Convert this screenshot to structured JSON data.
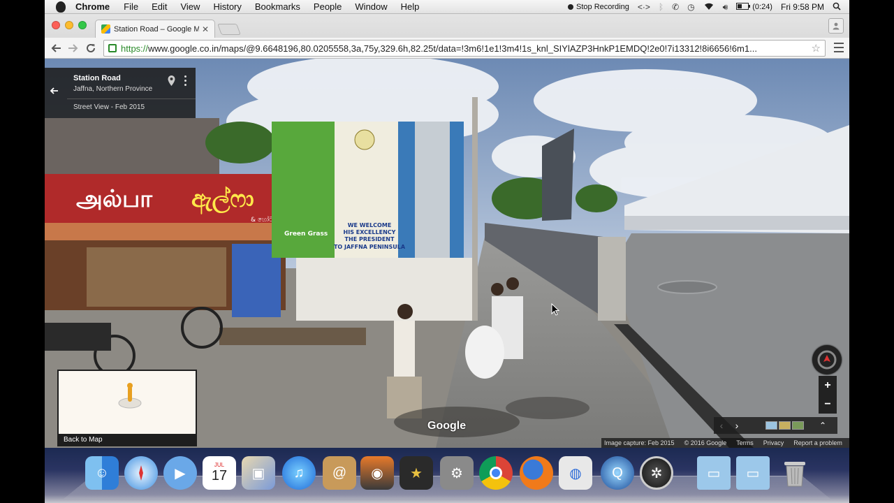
{
  "menubar": {
    "app_name": "Chrome",
    "menus": [
      "File",
      "Edit",
      "View",
      "History",
      "Bookmarks",
      "People",
      "Window",
      "Help"
    ],
    "recording_label": "Stop Recording",
    "battery_time": "(0:24)",
    "clock": "Fri 9:58 PM"
  },
  "browser": {
    "tab_title": "Station Road – Google Ma",
    "url_scheme": "https://",
    "url_rest": "www.google.co.in/maps/@9.6648196,80.0205558,3a,75y,329.6h,82.25t/data=!3m6!1e1!3m4!1s_knl_SIYlAZP3HnkP1EMDQ!2e0!7i13312!8i6656!6m1..."
  },
  "streetview": {
    "place_title": "Station Road",
    "place_subtitle": "Jaffna, Northern Province",
    "capture_label": "Street View - Feb 2015",
    "back_to_map": "Back to Map",
    "logo": "Google",
    "billboard_lines": [
      "WE WELCOME",
      "HIS EXCELLENCY",
      "THE PRESIDENT",
      "TO JAFFNA PENINSULA"
    ],
    "billboard_brand": "Green Grass",
    "shop_signs": [
      "அல்பா",
      "ඇල්ෆා"
    ],
    "shop_sign_small": "& හෝටල",
    "footer": {
      "image_capture": "Image capture: Feb 2015",
      "copyright": "© 2016 Google",
      "terms": "Terms",
      "privacy": "Privacy",
      "report": "Report a problem"
    },
    "zoom_in": "+",
    "zoom_out": "−"
  },
  "dock": {
    "calendar_month": "JUL",
    "calendar_day": "17"
  },
  "colors": {
    "sky": "#8ea6c6",
    "road": "#8c8c8c",
    "billboard_green": "#58a83c",
    "chrome_url_green": "#2a8a2a"
  }
}
